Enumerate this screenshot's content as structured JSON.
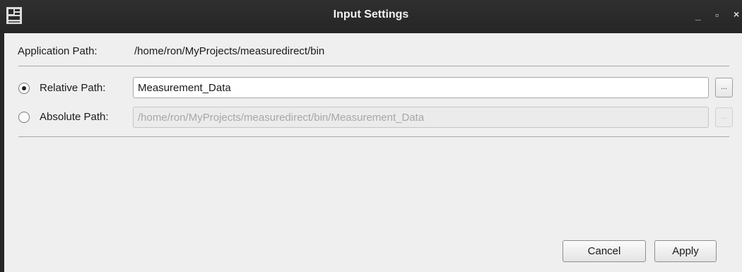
{
  "window": {
    "title": "Input Settings",
    "controls": {
      "minimize": "_",
      "maximize": "▫",
      "close": "×"
    }
  },
  "application_path": {
    "label": "Application Path:",
    "value": "/home/ron/MyProjects/measuredirect/bin"
  },
  "relative_path": {
    "label": "Relative Path:",
    "value": "Measurement_Data",
    "selected": true,
    "browse_label": "..."
  },
  "absolute_path": {
    "label": "Absolute Path:",
    "value": "/home/ron/MyProjects/measuredirect/bin/Measurement_Data",
    "selected": false,
    "enabled": false,
    "browse_label": "..."
  },
  "buttons": {
    "cancel": "Cancel",
    "apply": "Apply"
  }
}
